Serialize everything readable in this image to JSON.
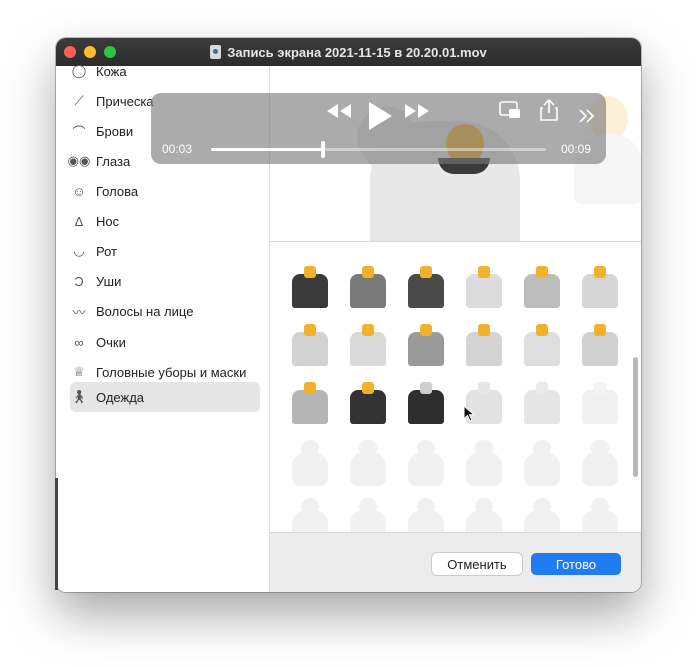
{
  "window": {
    "title": "Запись экрана 2021-11-15 в 20.20.01.mov"
  },
  "sidebar": {
    "items": [
      {
        "label": "Кожа",
        "icon": "skin-icon"
      },
      {
        "label": "Прическа",
        "icon": "comb-icon"
      },
      {
        "label": "Брови",
        "icon": "eyebrow-icon"
      },
      {
        "label": "Глаза",
        "icon": "eyes-icon"
      },
      {
        "label": "Голова",
        "icon": "head-icon"
      },
      {
        "label": "Нос",
        "icon": "nose-icon"
      },
      {
        "label": "Рот",
        "icon": "mouth-icon"
      },
      {
        "label": "Уши",
        "icon": "ear-icon"
      },
      {
        "label": "Волосы на лице",
        "icon": "mustache-icon"
      },
      {
        "label": "Очки",
        "icon": "glasses-icon"
      },
      {
        "label": "Головные уборы и маски",
        "icon": "crown-icon"
      },
      {
        "label": "Одежда",
        "icon": "person-walking-icon"
      }
    ],
    "selected": "Одежда"
  },
  "player": {
    "current_time": "00:03",
    "total_time": "00:09",
    "progress": 0.333
  },
  "footer": {
    "cancel_label": "Отменить",
    "done_label": "Готово"
  }
}
